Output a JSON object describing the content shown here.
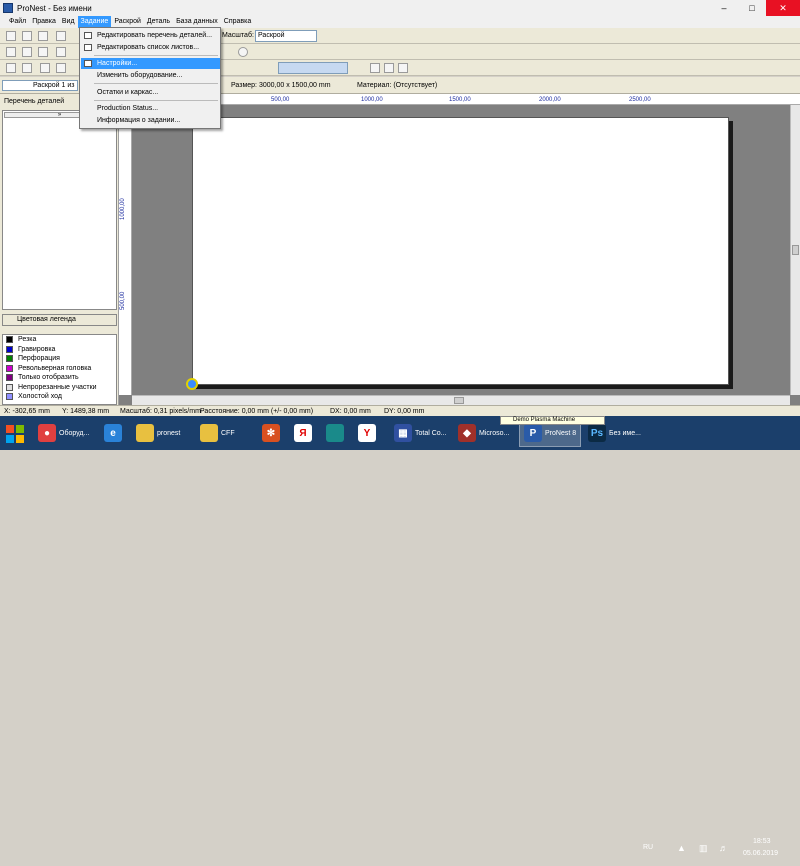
{
  "window": {
    "title": "ProNest - Без имени"
  },
  "menu": [
    "Файл",
    "Правка",
    "Вид",
    "Задание",
    "Раскрой",
    "Деталь",
    "База данных",
    "Справка"
  ],
  "toolbar": {
    "scale_label": "Масштаб:",
    "scale_value": "Раскрой"
  },
  "infobar": {
    "nest_select": "Раскрой 1 из",
    "size": "Размер: 3000,00 x 1500,00 mm",
    "material": "Материал: (Отсутствует)"
  },
  "left_panel": {
    "tab_label": "Перечень деталей",
    "legend_title": "Цветовая легенда",
    "legend": [
      {
        "label": "Резка",
        "color": "#000000"
      },
      {
        "label": "Гравировка",
        "color": "#0000cc"
      },
      {
        "label": "Перфорация",
        "color": "#008000"
      },
      {
        "label": "Револьверная головка",
        "color": "#cc00cc"
      },
      {
        "label": "Только отобразить",
        "color": "#800080"
      },
      {
        "label": "Непрорезанные участки",
        "color": "#e0e0e0"
      },
      {
        "label": "Холостой ход",
        "color": "#9090ff"
      }
    ]
  },
  "ruler": {
    "top": [
      "500,00",
      "1000,00",
      "1500,00",
      "2000,00",
      "2500,00"
    ],
    "left": [
      "1000,00",
      "500,00"
    ]
  },
  "dropdown": {
    "items": [
      "Редактировать перечень деталей...",
      "Редактировать список листов...",
      "Настройки...",
      "Изменить оборудование...",
      "Остатки и каркас...",
      "Production Status...",
      "Информация о задании..."
    ]
  },
  "status": {
    "x": "X: -302,65 mm",
    "y": "Y: 1489,38 mm",
    "scale": "Масштаб: 0,31 pixels/mm",
    "distance": "Расстояние: 0,00 mm (+/- 0,00 mm)",
    "dx": "DX: 0,00 mm",
    "dy": "DY: 0,00 mm"
  },
  "taskbar": {
    "tooltip": "Demo Plasma Machine",
    "buttons": [
      {
        "label": "Оборуд...",
        "icon": "chrome-icon"
      },
      {
        "label": "pronest",
        "icon": "folder-icon"
      },
      {
        "label": "CFF",
        "icon": "folder-icon"
      },
      {
        "label": "Total Co...",
        "icon": "totalcmd-icon"
      },
      {
        "label": "Microso...",
        "icon": "access-icon"
      },
      {
        "label": "ProNest 8",
        "icon": "pronest-icon"
      },
      {
        "label": "Без име...",
        "icon": "photoshop-icon"
      }
    ],
    "lang": "RU",
    "time": "18:53",
    "date": "05.06.2019"
  }
}
